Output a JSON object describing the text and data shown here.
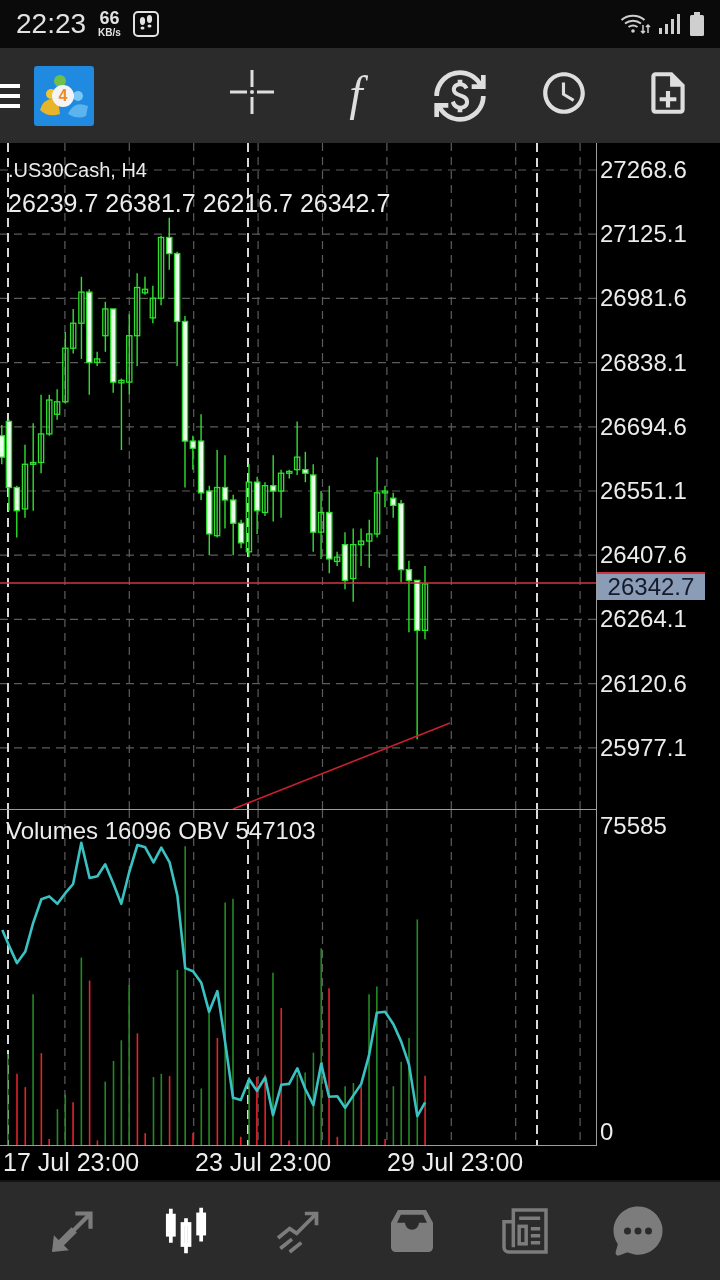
{
  "status_bar": {
    "time": "22:23",
    "net_speed": "66",
    "net_speed_unit": "KB/s"
  },
  "toolbar": {
    "logo_badge": "4",
    "indicators_label": "f"
  },
  "chart": {
    "symbol": ".US30Cash, H4",
    "ohlc": "26239.7 26381.7 26216.7 26342.7",
    "price_ticks": [
      "27268.6",
      "27125.1",
      "26981.6",
      "26838.1",
      "26694.6",
      "26551.1",
      "26407.6",
      "26264.1",
      "26120.6",
      "25977.1"
    ],
    "current_price": "26342.7",
    "indicator_label": "Volumes 16096 OBV 547103",
    "volume_ticks": [
      "75585",
      "0"
    ],
    "time_ticks": [
      "17 Jul 23:00",
      "23 Jul 23:00",
      "29 Jul 23:00"
    ]
  },
  "bottom_nav": [
    {
      "selected": false
    },
    {
      "selected": true
    },
    {
      "selected": false
    },
    {
      "selected": false
    },
    {
      "selected": false
    },
    {
      "selected": false
    }
  ]
}
